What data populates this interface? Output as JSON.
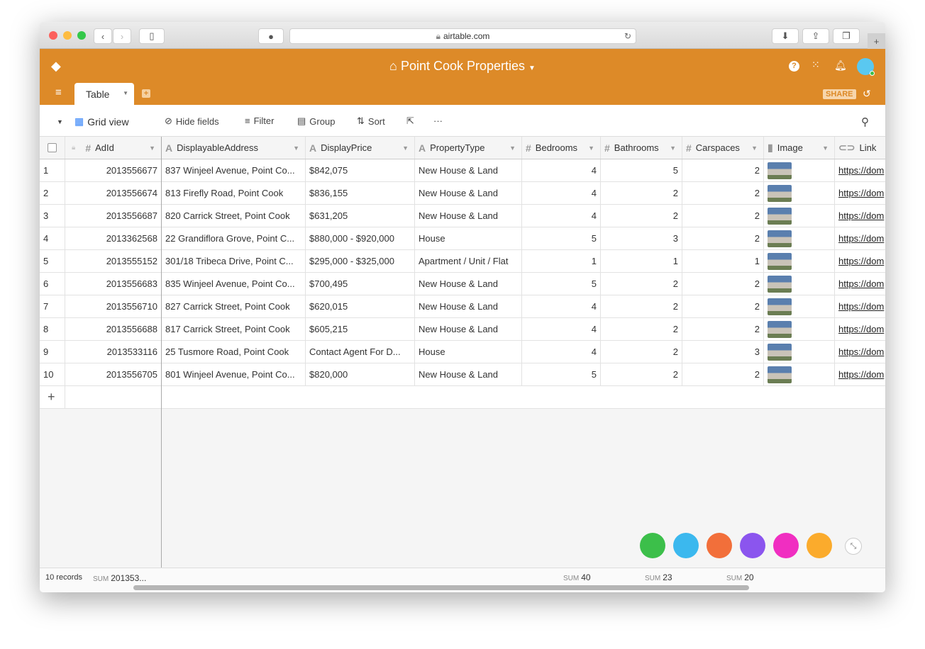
{
  "browser": {
    "url": "airtable.com"
  },
  "header": {
    "base_title": "Point Cook Properties",
    "share_label": "SHARE",
    "tab_label": "Table",
    "accent": "#dd8a28"
  },
  "toolbar": {
    "view": "Grid view",
    "hide_fields": "Hide fields",
    "filter": "Filter",
    "group": "Group",
    "sort": "Sort"
  },
  "columns": [
    {
      "name": "AdId",
      "icon": "number-icon"
    },
    {
      "name": "DisplayableAddress",
      "icon": "text-icon"
    },
    {
      "name": "DisplayPrice",
      "icon": "text-icon"
    },
    {
      "name": "PropertyType",
      "icon": "text-icon"
    },
    {
      "name": "Bedrooms",
      "icon": "number-icon"
    },
    {
      "name": "Bathrooms",
      "icon": "number-icon"
    },
    {
      "name": "Carspaces",
      "icon": "number-icon"
    },
    {
      "name": "Image",
      "icon": "attachment-icon"
    },
    {
      "name": "Link",
      "icon": "link-icon"
    }
  ],
  "rows": [
    {
      "n": "1",
      "id": "2013556677",
      "addr": "837 Winjeel Avenue, Point Co...",
      "price": "$842,075",
      "type": "New House & Land",
      "bed": "4",
      "bath": "5",
      "car": "2",
      "link": "https://dom"
    },
    {
      "n": "2",
      "id": "2013556674",
      "addr": "813 Firefly Road, Point Cook",
      "price": "$836,155",
      "type": "New House & Land",
      "bed": "4",
      "bath": "2",
      "car": "2",
      "link": "https://dom"
    },
    {
      "n": "3",
      "id": "2013556687",
      "addr": "820 Carrick Street, Point Cook",
      "price": "$631,205",
      "type": "New House & Land",
      "bed": "4",
      "bath": "2",
      "car": "2",
      "link": "https://dom"
    },
    {
      "n": "4",
      "id": "2013362568",
      "addr": "22 Grandiflora Grove, Point C...",
      "price": "$880,000 - $920,000",
      "type": "House",
      "bed": "5",
      "bath": "3",
      "car": "2",
      "link": "https://dom"
    },
    {
      "n": "5",
      "id": "2013555152",
      "addr": "301/18 Tribeca Drive, Point C...",
      "price": "$295,000 - $325,000",
      "type": "Apartment / Unit / Flat",
      "bed": "1",
      "bath": "1",
      "car": "1",
      "link": "https://dom"
    },
    {
      "n": "6",
      "id": "2013556683",
      "addr": "835 Winjeel Avenue, Point Co...",
      "price": "$700,495",
      "type": "New House & Land",
      "bed": "5",
      "bath": "2",
      "car": "2",
      "link": "https://dom"
    },
    {
      "n": "7",
      "id": "2013556710",
      "addr": "827 Carrick Street, Point Cook",
      "price": "$620,015",
      "type": "New House & Land",
      "bed": "4",
      "bath": "2",
      "car": "2",
      "link": "https://dom"
    },
    {
      "n": "8",
      "id": "2013556688",
      "addr": "817 Carrick Street, Point Cook",
      "price": "$605,215",
      "type": "New House & Land",
      "bed": "4",
      "bath": "2",
      "car": "2",
      "link": "https://dom"
    },
    {
      "n": "9",
      "id": "2013533116",
      "addr": "25 Tusmore Road, Point Cook",
      "price": "Contact Agent For D...",
      "type": "House",
      "bed": "4",
      "bath": "2",
      "car": "3",
      "link": "https://dom"
    },
    {
      "n": "10",
      "id": "2013556705",
      "addr": "801 Winjeel Avenue, Point Co...",
      "price": "$820,000",
      "type": "New House & Land",
      "bed": "5",
      "bath": "2",
      "car": "2",
      "link": "https://dom"
    }
  ],
  "footer": {
    "records": "10 records",
    "sum_label": "SUM",
    "sum_adid": "201353...",
    "sum_bed": "40",
    "sum_bath": "23",
    "sum_car": "20"
  },
  "apps": [
    {
      "name": "green-app",
      "color": "#3cbf4a"
    },
    {
      "name": "blue-app",
      "color": "#3bb8ee"
    },
    {
      "name": "orange-app",
      "color": "#f26f3a"
    },
    {
      "name": "purple-app",
      "color": "#8b55ee"
    },
    {
      "name": "pink-app",
      "color": "#f02ec1"
    },
    {
      "name": "more-app",
      "color": "#fbab2c"
    }
  ]
}
